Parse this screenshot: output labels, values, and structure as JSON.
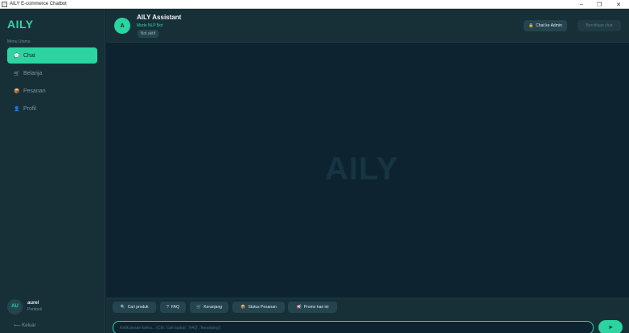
{
  "window": {
    "title": "AILY E-commerce Chatbot",
    "min_label": "–",
    "max_label": "❐",
    "close_label": "✕"
  },
  "sidebar": {
    "logo": "AILY",
    "menu_heading": "Menu Utama",
    "items": [
      {
        "label": "Chat",
        "icon": "chat-bubble-icon",
        "glyph": "💬",
        "active": true
      },
      {
        "label": "Belanja",
        "icon": "cart-icon",
        "glyph": "🛒",
        "active": false
      },
      {
        "label": "Pesanan",
        "icon": "package-icon",
        "glyph": "📦",
        "active": false
      },
      {
        "label": "Profil",
        "icon": "person-icon",
        "glyph": "👤",
        "active": false
      }
    ],
    "user": {
      "initials": "AU",
      "name": "aurel",
      "role": "Pembeli"
    },
    "logout_label": "⟵ Keluar"
  },
  "header": {
    "avatar_letter": "A",
    "bot_name": "AILY Assistant",
    "mode": "Mode NLP Bot",
    "status": "Bot aktif",
    "admin_button": "Chat ke Admin",
    "admin_icon_glyph": "🔒",
    "clear_button": "Bersihkan chat"
  },
  "messages": {
    "watermark": "AILY"
  },
  "quick_replies": [
    {
      "label": "Cari produk",
      "glyph": "🔍"
    },
    {
      "label": "FAQ",
      "glyph": "?"
    },
    {
      "label": "Keranjang",
      "glyph": "🛒"
    },
    {
      "label": "Status Pesanan",
      "glyph": "📦"
    },
    {
      "label": "Promo hari ini",
      "glyph": "📢"
    }
  ],
  "input": {
    "value": "",
    "placeholder": "Ketik pesan kamu... (Cth: 'cari laptop', 'FAQ', 'keranjang')",
    "send_glyph": "➤"
  },
  "colors": {
    "accent": "#2bd4a0",
    "sidebar_bg": "#173038",
    "main_bg": "#0d2430"
  }
}
